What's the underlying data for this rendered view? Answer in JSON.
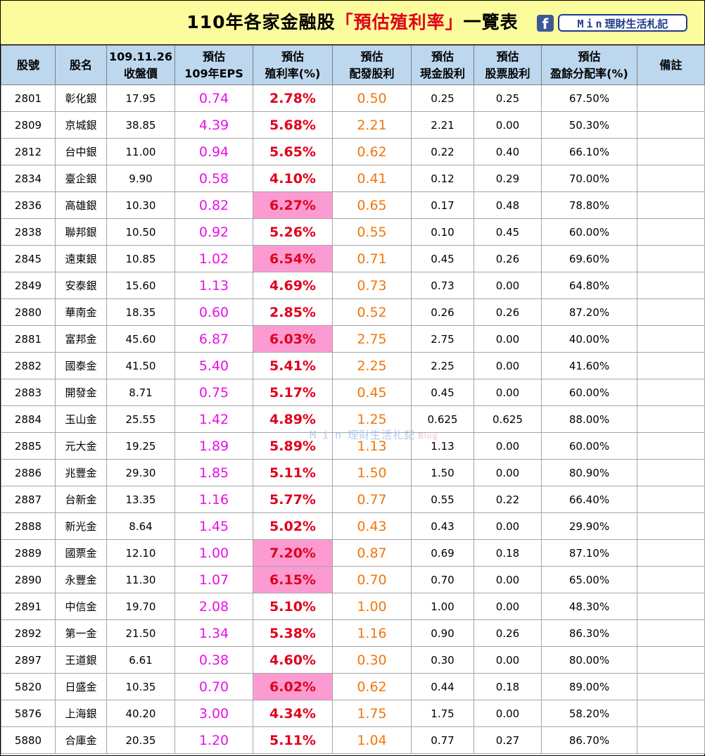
{
  "title": {
    "prefix": "110年各家金融股",
    "highlight": "「預估殖利率」",
    "suffix": "一覽表"
  },
  "badge": {
    "icon": "f",
    "min": "Min",
    "label": "理財生活札記"
  },
  "watermark": {
    "min": "Min",
    "label": "理財生活札記",
    "blog": "Blog"
  },
  "headers": {
    "code": [
      "股號"
    ],
    "name": [
      "股名"
    ],
    "price": [
      "109.11.26",
      "收盤價"
    ],
    "eps": [
      "預估",
      "109年EPS"
    ],
    "yield": [
      "預估",
      "殖利率(%)"
    ],
    "dividend": [
      "預估",
      "配發股利"
    ],
    "cash": [
      "預估",
      "現金股利"
    ],
    "stock": [
      "預估",
      "股票股利"
    ],
    "payout": [
      "預估",
      "盈餘分配率(%)"
    ],
    "note": [
      "備註"
    ]
  },
  "colors": {
    "title_bg": "#fdfc9d",
    "header_bg": "#bdd7ee",
    "eps": "#ea0fe9",
    "yield": "#e0001b",
    "yield_highlight_bg": "#fc9bd2",
    "dividend": "#f2760b"
  },
  "rows": [
    {
      "code": "2801",
      "name": "彰化銀",
      "price": "17.95",
      "eps": "0.74",
      "yield": "2.78%",
      "dividend": "0.50",
      "cash": "0.25",
      "stock": "0.25",
      "payout": "67.50%",
      "note": "",
      "hot": false
    },
    {
      "code": "2809",
      "name": "京城銀",
      "price": "38.85",
      "eps": "4.39",
      "yield": "5.68%",
      "dividend": "2.21",
      "cash": "2.21",
      "stock": "0.00",
      "payout": "50.30%",
      "note": "",
      "hot": false
    },
    {
      "code": "2812",
      "name": "台中銀",
      "price": "11.00",
      "eps": "0.94",
      "yield": "5.65%",
      "dividend": "0.62",
      "cash": "0.22",
      "stock": "0.40",
      "payout": "66.10%",
      "note": "",
      "hot": false
    },
    {
      "code": "2834",
      "name": "臺企銀",
      "price": "9.90",
      "eps": "0.58",
      "yield": "4.10%",
      "dividend": "0.41",
      "cash": "0.12",
      "stock": "0.29",
      "payout": "70.00%",
      "note": "",
      "hot": false
    },
    {
      "code": "2836",
      "name": "高雄銀",
      "price": "10.30",
      "eps": "0.82",
      "yield": "6.27%",
      "dividend": "0.65",
      "cash": "0.17",
      "stock": "0.48",
      "payout": "78.80%",
      "note": "",
      "hot": true
    },
    {
      "code": "2838",
      "name": "聯邦銀",
      "price": "10.50",
      "eps": "0.92",
      "yield": "5.26%",
      "dividend": "0.55",
      "cash": "0.10",
      "stock": "0.45",
      "payout": "60.00%",
      "note": "",
      "hot": false
    },
    {
      "code": "2845",
      "name": "遠東銀",
      "price": "10.85",
      "eps": "1.02",
      "yield": "6.54%",
      "dividend": "0.71",
      "cash": "0.45",
      "stock": "0.26",
      "payout": "69.60%",
      "note": "",
      "hot": true
    },
    {
      "code": "2849",
      "name": "安泰銀",
      "price": "15.60",
      "eps": "1.13",
      "yield": "4.69%",
      "dividend": "0.73",
      "cash": "0.73",
      "stock": "0.00",
      "payout": "64.80%",
      "note": "",
      "hot": false
    },
    {
      "code": "2880",
      "name": "華南金",
      "price": "18.35",
      "eps": "0.60",
      "yield": "2.85%",
      "dividend": "0.52",
      "cash": "0.26",
      "stock": "0.26",
      "payout": "87.20%",
      "note": "",
      "hot": false
    },
    {
      "code": "2881",
      "name": "富邦金",
      "price": "45.60",
      "eps": "6.87",
      "yield": "6.03%",
      "dividend": "2.75",
      "cash": "2.75",
      "stock": "0.00",
      "payout": "40.00%",
      "note": "",
      "hot": true
    },
    {
      "code": "2882",
      "name": "國泰金",
      "price": "41.50",
      "eps": "5.40",
      "yield": "5.41%",
      "dividend": "2.25",
      "cash": "2.25",
      "stock": "0.00",
      "payout": "41.60%",
      "note": "",
      "hot": false
    },
    {
      "code": "2883",
      "name": "開發金",
      "price": "8.71",
      "eps": "0.75",
      "yield": "5.17%",
      "dividend": "0.45",
      "cash": "0.45",
      "stock": "0.00",
      "payout": "60.00%",
      "note": "",
      "hot": false
    },
    {
      "code": "2884",
      "name": "玉山金",
      "price": "25.55",
      "eps": "1.42",
      "yield": "4.89%",
      "dividend": "1.25",
      "cash": "0.625",
      "stock": "0.625",
      "payout": "88.00%",
      "note": "",
      "hot": false
    },
    {
      "code": "2885",
      "name": "元大金",
      "price": "19.25",
      "eps": "1.89",
      "yield": "5.89%",
      "dividend": "1.13",
      "cash": "1.13",
      "stock": "0.00",
      "payout": "60.00%",
      "note": "",
      "hot": false
    },
    {
      "code": "2886",
      "name": "兆豐金",
      "price": "29.30",
      "eps": "1.85",
      "yield": "5.11%",
      "dividend": "1.50",
      "cash": "1.50",
      "stock": "0.00",
      "payout": "80.90%",
      "note": "",
      "hot": false
    },
    {
      "code": "2887",
      "name": "台新金",
      "price": "13.35",
      "eps": "1.16",
      "yield": "5.77%",
      "dividend": "0.77",
      "cash": "0.55",
      "stock": "0.22",
      "payout": "66.40%",
      "note": "",
      "hot": false
    },
    {
      "code": "2888",
      "name": "新光金",
      "price": "8.64",
      "eps": "1.45",
      "yield": "5.02%",
      "dividend": "0.43",
      "cash": "0.43",
      "stock": "0.00",
      "payout": "29.90%",
      "note": "",
      "hot": false
    },
    {
      "code": "2889",
      "name": "國票金",
      "price": "12.10",
      "eps": "1.00",
      "yield": "7.20%",
      "dividend": "0.87",
      "cash": "0.69",
      "stock": "0.18",
      "payout": "87.10%",
      "note": "",
      "hot": true
    },
    {
      "code": "2890",
      "name": "永豐金",
      "price": "11.30",
      "eps": "1.07",
      "yield": "6.15%",
      "dividend": "0.70",
      "cash": "0.70",
      "stock": "0.00",
      "payout": "65.00%",
      "note": "",
      "hot": true
    },
    {
      "code": "2891",
      "name": "中信金",
      "price": "19.70",
      "eps": "2.08",
      "yield": "5.10%",
      "dividend": "1.00",
      "cash": "1.00",
      "stock": "0.00",
      "payout": "48.30%",
      "note": "",
      "hot": false
    },
    {
      "code": "2892",
      "name": "第一金",
      "price": "21.50",
      "eps": "1.34",
      "yield": "5.38%",
      "dividend": "1.16",
      "cash": "0.90",
      "stock": "0.26",
      "payout": "86.30%",
      "note": "",
      "hot": false
    },
    {
      "code": "2897",
      "name": "王道銀",
      "price": "6.61",
      "eps": "0.38",
      "yield": "4.60%",
      "dividend": "0.30",
      "cash": "0.30",
      "stock": "0.00",
      "payout": "80.00%",
      "note": "",
      "hot": false
    },
    {
      "code": "5820",
      "name": "日盛金",
      "price": "10.35",
      "eps": "0.70",
      "yield": "6.02%",
      "dividend": "0.62",
      "cash": "0.44",
      "stock": "0.18",
      "payout": "89.00%",
      "note": "",
      "hot": true
    },
    {
      "code": "5876",
      "name": "上海銀",
      "price": "40.20",
      "eps": "3.00",
      "yield": "4.34%",
      "dividend": "1.75",
      "cash": "1.75",
      "stock": "0.00",
      "payout": "58.20%",
      "note": "",
      "hot": false
    },
    {
      "code": "5880",
      "name": "合庫金",
      "price": "20.35",
      "eps": "1.20",
      "yield": "5.11%",
      "dividend": "1.04",
      "cash": "0.77",
      "stock": "0.27",
      "payout": "86.70%",
      "note": "",
      "hot": false
    }
  ]
}
